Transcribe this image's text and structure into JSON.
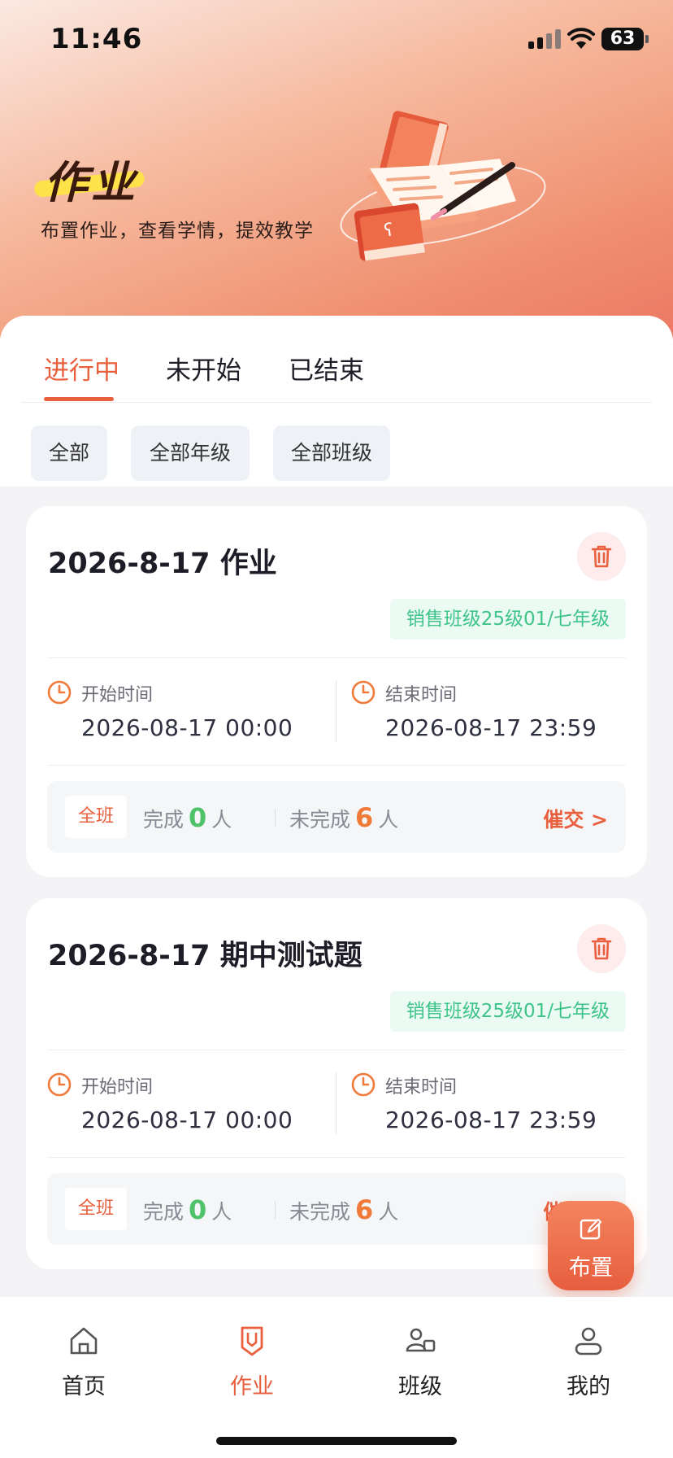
{
  "status_bar": {
    "time": "11:46",
    "battery": "63"
  },
  "hero": {
    "title": "作业",
    "subtitle": "布置作业，查看学情，提效教学"
  },
  "tabs": [
    {
      "label": "进行中",
      "active": true
    },
    {
      "label": "未开始",
      "active": false
    },
    {
      "label": "已结束",
      "active": false
    }
  ],
  "filters": [
    "全部",
    "全部年级",
    "全部班级"
  ],
  "cards": [
    {
      "title": "2026-8-17 作业",
      "class_tag": "销售班级25级01/七年级",
      "start_label": "开始时间",
      "start_value": "2026-08-17 00:00",
      "end_label": "结束时间",
      "end_value": "2026-08-17 23:59",
      "scope": "全班",
      "done_label": "完成",
      "done_count": "0",
      "undone_label": "未完成",
      "undone_count": "6",
      "person_unit": "人",
      "urge_label": "催交 >"
    },
    {
      "title": "2026-8-17 期中测试题",
      "class_tag": "销售班级25级01/七年级",
      "start_label": "开始时间",
      "start_value": "2026-08-17 00:00",
      "end_label": "结束时间",
      "end_value": "2026-08-17 23:59",
      "scope": "全班",
      "done_label": "完成",
      "done_count": "0",
      "undone_label": "未完成",
      "undone_count": "6",
      "person_unit": "人",
      "urge_label": "催交 >"
    }
  ],
  "fab": {
    "label": "布置",
    "icon": "edit-icon"
  },
  "bottom_nav": [
    {
      "label": "首页",
      "icon": "home-icon",
      "active": false
    },
    {
      "label": "作业",
      "icon": "homework-icon",
      "active": true
    },
    {
      "label": "班级",
      "icon": "class-icon",
      "active": false
    },
    {
      "label": "我的",
      "icon": "profile-icon",
      "active": false
    }
  ],
  "colors": {
    "accent": "#e8603e",
    "green": "#4fc26a",
    "orange": "#ef7a3a",
    "tag_green": "#3ec489"
  }
}
